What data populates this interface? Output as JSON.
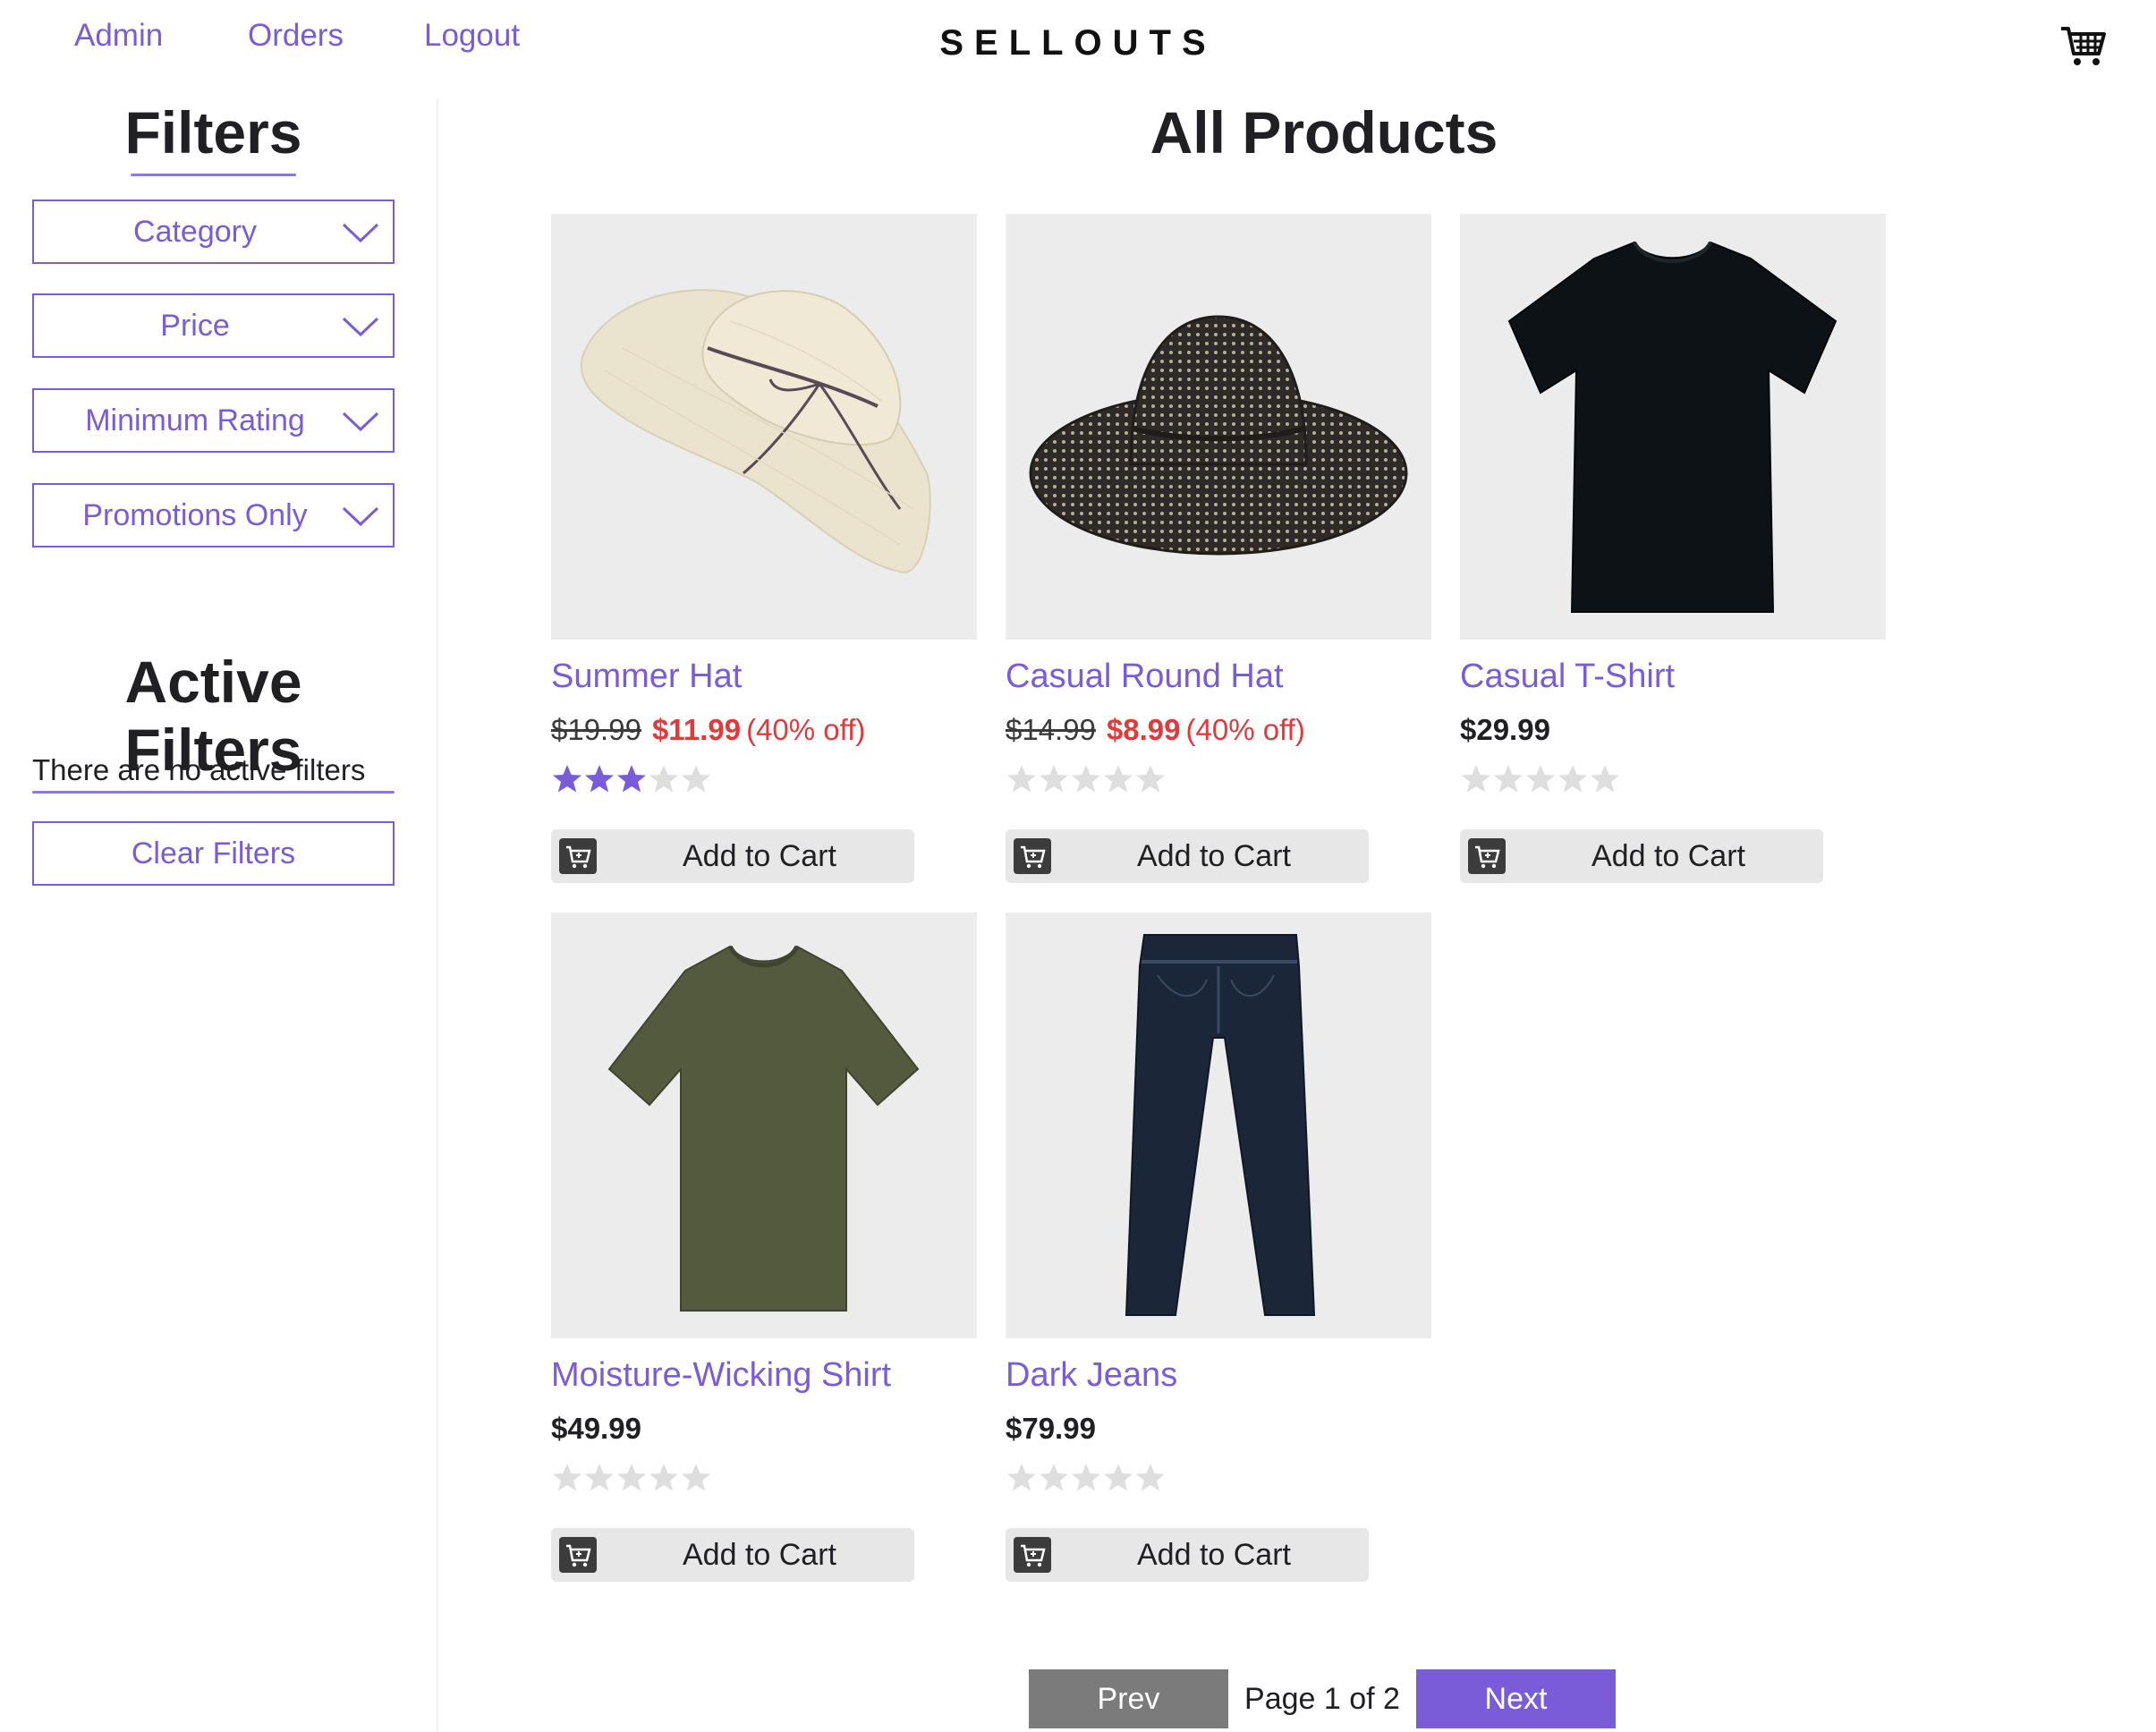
{
  "nav": {
    "links": [
      "Admin",
      "Orders",
      "Logout"
    ],
    "brand": "SELLOUTS",
    "cart_icon": "cart-icon"
  },
  "sidebar": {
    "filters_title": "Filters",
    "filters": [
      "Category",
      "Price",
      "Minimum Rating",
      "Promotions Only"
    ],
    "active_title": "Active Filters",
    "active_empty": "There are no active filters",
    "clear_label": "Clear Filters"
  },
  "main": {
    "title": "All Products",
    "add_to_cart_label": "Add to Cart",
    "products": [
      {
        "name": "Summer Hat",
        "original_price": "$19.99",
        "price": "$11.99",
        "discount": "(40% off)",
        "rating": 3,
        "image": "straw-hat-image"
      },
      {
        "name": "Casual Round Hat",
        "original_price": "$14.99",
        "price": "$8.99",
        "discount": "(40% off)",
        "rating": 0,
        "image": "bucket-hat-image"
      },
      {
        "name": "Casual T-Shirt",
        "original_price": "",
        "price": "$29.99",
        "discount": "",
        "rating": 0,
        "image": "black-tshirt-image"
      },
      {
        "name": "Moisture-Wicking Shirt",
        "original_price": "",
        "price": "$49.99",
        "discount": "",
        "rating": 0,
        "image": "olive-shirt-image"
      },
      {
        "name": "Dark Jeans",
        "original_price": "",
        "price": "$79.99",
        "discount": "",
        "rating": 0,
        "image": "jeans-image"
      }
    ]
  },
  "pagination": {
    "prev_label": "Prev",
    "page_info": "Page 1 of 2",
    "next_label": "Next"
  },
  "colors": {
    "accent": "#7a5cd8",
    "sale": "#e03a3a",
    "star_filled": "#7a5cd8",
    "star_empty": "#dedede",
    "prev_button": "#7b7b7b"
  }
}
